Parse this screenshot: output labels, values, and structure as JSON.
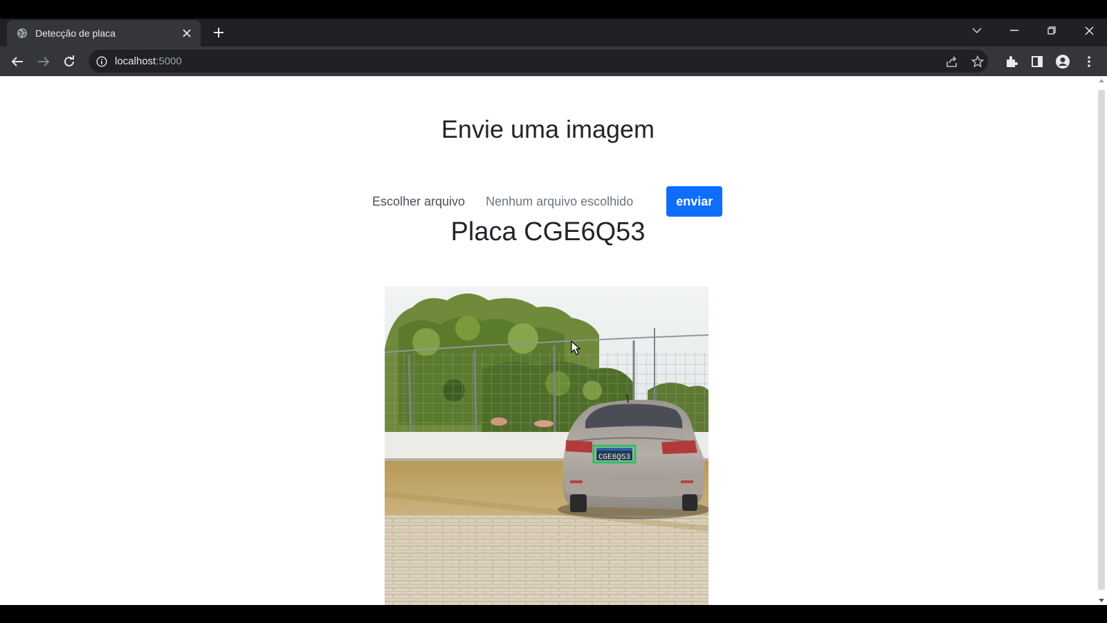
{
  "browser": {
    "tab_title": "Detecção de placa",
    "url_host": "localhost",
    "url_port": ":5000"
  },
  "page": {
    "heading": "Envie uma imagem",
    "choose_file_label": "Escolher arquivo",
    "no_file_label": "Nenhum arquivo escolhido",
    "submit_label": "enviar",
    "result_label": "Placa CGE6Q53",
    "plate_text": "CGE6Q53"
  },
  "colors": {
    "submit_bg": "#0d6efd",
    "plate_box": "#22c55e"
  }
}
